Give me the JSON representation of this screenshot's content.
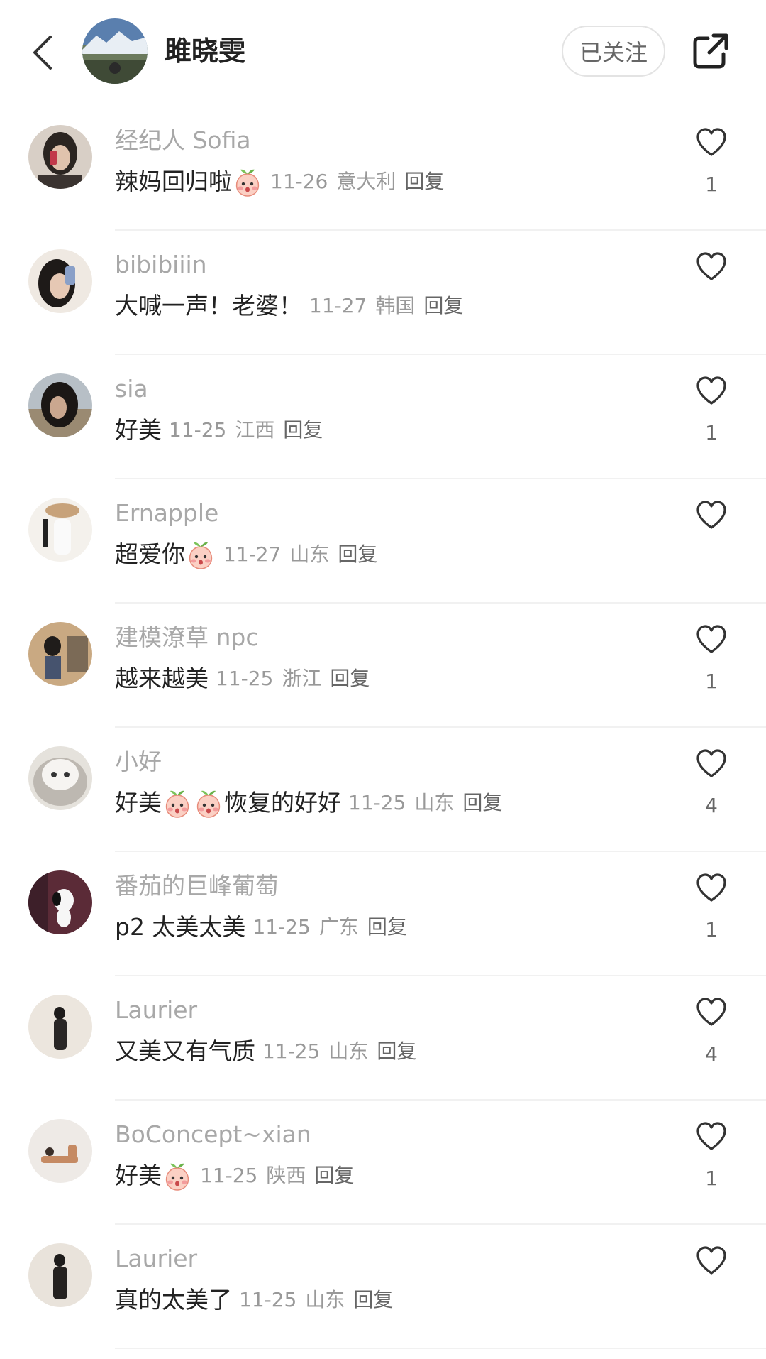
{
  "header": {
    "name": "雎晓雯",
    "follow_label": "已关注"
  },
  "colors": {
    "username": "#a8a8a8",
    "meta": "#999999",
    "text": "#222222",
    "border": "#e3e3e3"
  },
  "comments": [
    {
      "user": "经纪人 Sofia",
      "text": "辣妈回归啦",
      "emoji_after": 1,
      "date": "11-26",
      "location": "意大利",
      "reply": "回复",
      "likes": "1"
    },
    {
      "user": "bibibiiin",
      "text": "大喊一声！老婆！",
      "emoji_after": 0,
      "date": "11-27",
      "location": "韩国",
      "reply": "回复",
      "likes": ""
    },
    {
      "user": " sia",
      "text": "好美",
      "emoji_after": 0,
      "date": "11-25",
      "location": "江西",
      "reply": "回复",
      "likes": "1"
    },
    {
      "user": "Ernapple",
      "text": "超爱你",
      "emoji_after": 1,
      "date": "11-27",
      "location": "山东",
      "reply": "回复",
      "likes": ""
    },
    {
      "user": "建模潦草 npc",
      "text": "越来越美",
      "emoji_after": 0,
      "date": "11-25",
      "location": "浙江",
      "reply": "回复",
      "likes": "1"
    },
    {
      "user": "小好",
      "text": "好美",
      "text2": "恢复的好好",
      "emoji_after": 2,
      "date": "11-25",
      "location": "山东",
      "reply": "回复",
      "likes": "4"
    },
    {
      "user": "番茄的巨峰葡萄",
      "text": "p2 太美太美",
      "emoji_after": 0,
      "date": "11-25",
      "location": "广东",
      "reply": "回复",
      "likes": "1"
    },
    {
      "user": "Laurier",
      "text": "又美又有气质",
      "emoji_after": 0,
      "date": "11-25",
      "location": "山东",
      "reply": "回复",
      "likes": "4"
    },
    {
      "user": "BoConcept~xian",
      "text": "好美",
      "emoji_after": 1,
      "date": "11-25",
      "location": "陕西",
      "reply": "回复",
      "likes": "1"
    },
    {
      "user": "Laurier",
      "text": "真的太美了",
      "emoji_after": 0,
      "date": "11-25",
      "location": "山东",
      "reply": "回复",
      "likes": ""
    }
  ],
  "icons": {
    "back": "chevron-left-icon",
    "share": "share-icon",
    "like": "heart-outline-icon",
    "emoji": "blushing-peach-emoji-icon"
  }
}
